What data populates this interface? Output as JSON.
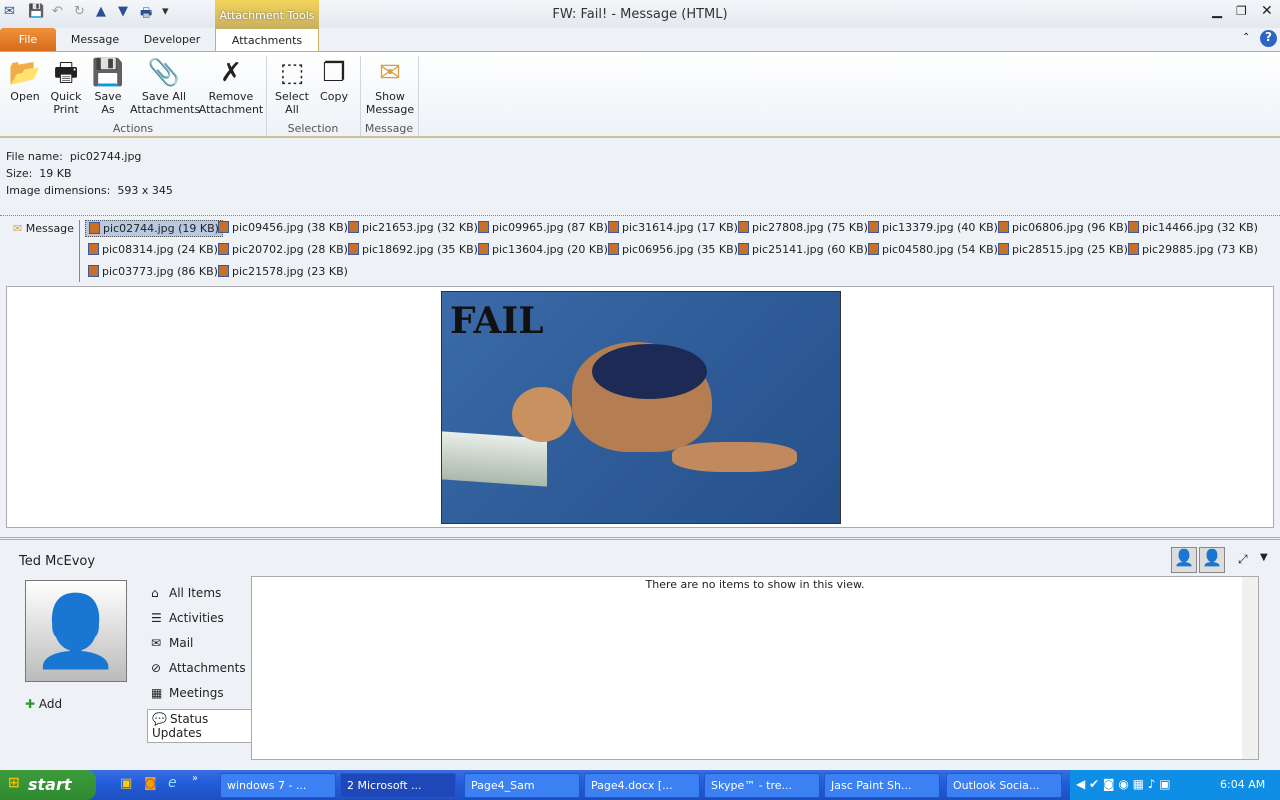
{
  "window": {
    "title": "FW: Fail!  -  Message (HTML)",
    "context_tab": "Attachment Tools"
  },
  "tabs": [
    "File",
    "Message",
    "Developer",
    "Attachments"
  ],
  "ribbon": {
    "actions": [
      {
        "label": "Open",
        "icon": "folder-open-icon"
      },
      {
        "label": "Quick Print",
        "icon": "printer-icon"
      },
      {
        "label": "Save As",
        "icon": "save-as-icon"
      },
      {
        "label": "Save All Attachments",
        "icon": "save-all-icon"
      },
      {
        "label": "Remove Attachment",
        "icon": "remove-x-icon"
      }
    ],
    "selection": [
      {
        "label": "Select All",
        "icon": "select-all-icon"
      },
      {
        "label": "Copy",
        "icon": "copy-icon"
      }
    ],
    "message": [
      {
        "label": "Show Message",
        "icon": "envelope-icon"
      }
    ],
    "groups": [
      "Actions",
      "Selection",
      "Message"
    ]
  },
  "info": {
    "file_name_label": "File name:",
    "file_name": "pic02744.jpg",
    "size_label": "Size:",
    "size": "19 KB",
    "dims_label": "Image dimensions:",
    "dims": "593 x 345"
  },
  "message_link": "Message",
  "attachments": [
    "pic02744.jpg (19 KB)",
    "pic09456.jpg (38 KB)",
    "pic21653.jpg (32 KB)",
    "pic09965.jpg (87 KB)",
    "pic31614.jpg (17 KB)",
    "pic27808.jpg (75 KB)",
    "pic13379.jpg (40 KB)",
    "pic06806.jpg (96 KB)",
    "pic14466.jpg (32 KB)",
    "pic08314.jpg (24 KB)",
    "pic20702.jpg (28 KB)",
    "pic18692.jpg (35 KB)",
    "pic13604.jpg (20 KB)",
    "pic06956.jpg (35 KB)",
    "pic25141.jpg (60 KB)",
    "pic04580.jpg (54 KB)",
    "pic28515.jpg (25 KB)",
    "pic29885.jpg (73 KB)",
    "pic03773.jpg (86 KB)",
    "pic21578.jpg (23 KB)"
  ],
  "preview": {
    "caption": "FAIL"
  },
  "people": {
    "name": "Ted McEvoy",
    "add": "Add",
    "nav": [
      "All Items",
      "Activities",
      "Mail",
      "Attachments",
      "Meetings",
      "Status Updates"
    ],
    "empty": "There are no items to show in this view."
  },
  "taskbar": {
    "start": "start",
    "items": [
      "windows 7 - ...",
      "2 Microsoft ...",
      "Page4_Sam",
      "Page4.docx [...",
      "Skype™ - tre...",
      "Jasc Paint Sh...",
      "Outlook Socia..."
    ],
    "clock": "6:04 AM"
  }
}
